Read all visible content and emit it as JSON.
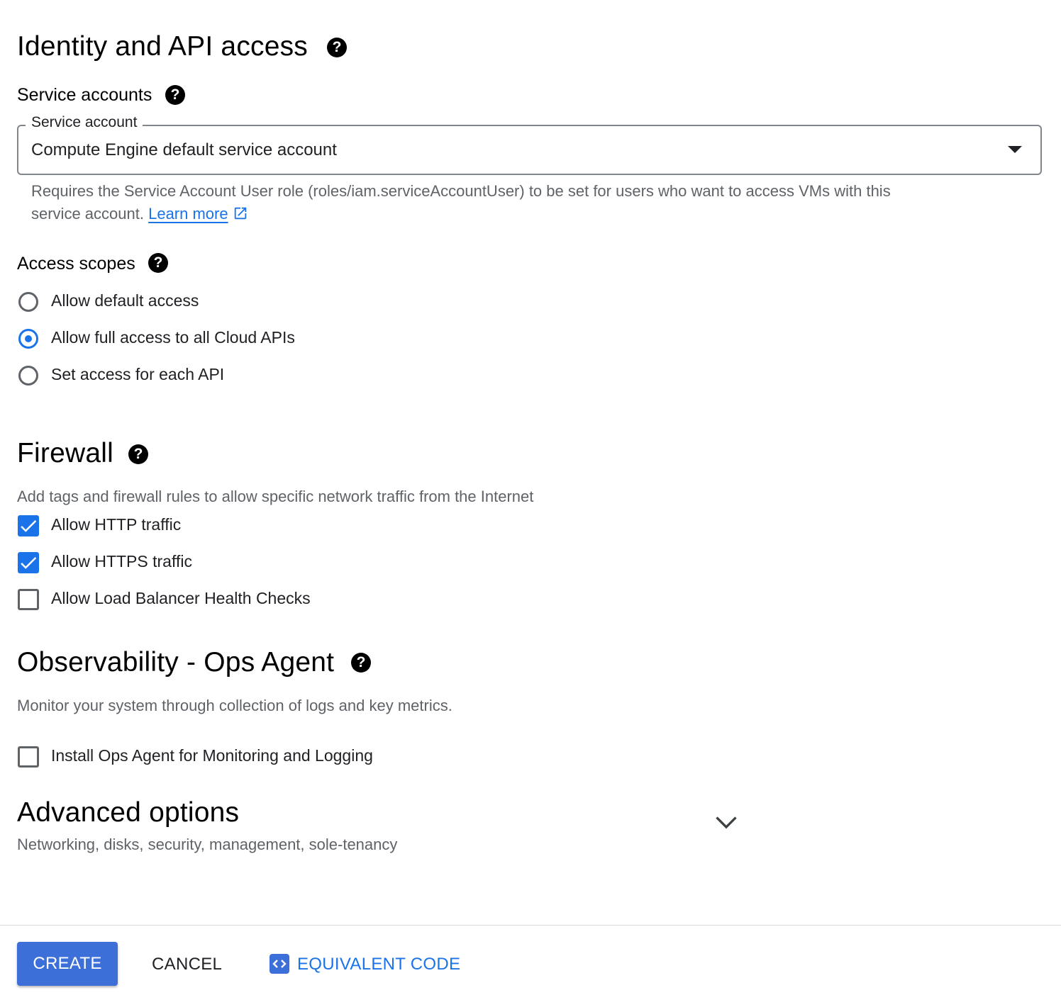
{
  "identity": {
    "title": "Identity and API access",
    "service_accounts": {
      "label": "Service accounts",
      "field_label": "Service account",
      "selected": "Compute Engine default service account",
      "helper_line1": "Requires the Service Account User role (roles/iam.serviceAccountUser) to be set for users who want to access VMs with this",
      "helper_line2": "service account.",
      "learn_more": "Learn more"
    },
    "access_scopes": {
      "label": "Access scopes",
      "options": [
        {
          "label": "Allow default access",
          "selected": false
        },
        {
          "label": "Allow full access to all Cloud APIs",
          "selected": true
        },
        {
          "label": "Set access for each API",
          "selected": false
        }
      ]
    }
  },
  "firewall": {
    "title": "Firewall",
    "description": "Add tags and firewall rules to allow specific network traffic from the Internet",
    "options": [
      {
        "label": "Allow HTTP traffic",
        "checked": true
      },
      {
        "label": "Allow HTTPS traffic",
        "checked": true
      },
      {
        "label": "Allow Load Balancer Health Checks",
        "checked": false
      }
    ]
  },
  "observability": {
    "title": "Observability - Ops Agent",
    "description": "Monitor your system through collection of logs and key metrics.",
    "option": {
      "label": "Install Ops Agent for Monitoring and Logging",
      "checked": false
    }
  },
  "advanced": {
    "title": "Advanced options",
    "subtitle": "Networking, disks, security, management, sole-tenancy"
  },
  "footer": {
    "create_label": "CREATE",
    "cancel_label": "CANCEL",
    "code_label": "EQUIVALENT CODE"
  },
  "icons": {
    "help": "?",
    "help_icon_name": "help-circle-icon",
    "external_link_icon_name": "open-in-new-icon",
    "dropdown_icon_name": "arrow-drop-down-icon",
    "expand_icon_name": "chevron-down-icon",
    "code_icon_name": "code-icon"
  },
  "colors": {
    "accent": "#1a73e8",
    "primary_button": "#3c6fd8",
    "muted_text": "#5f6368",
    "divider": "#dadce0"
  }
}
